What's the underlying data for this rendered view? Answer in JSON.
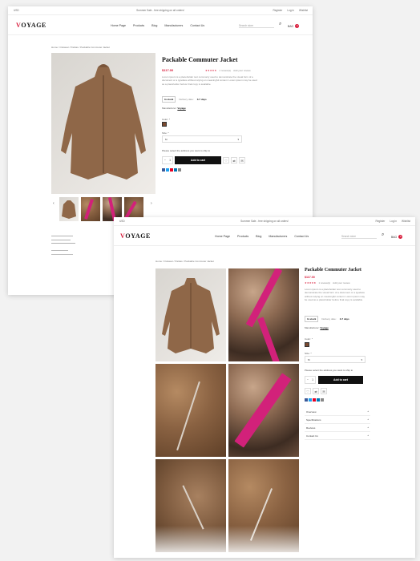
{
  "topbar": {
    "currency": "USD",
    "announcement": "Summer Sale - free shipping on all orders!",
    "links": [
      "Register",
      "Log in",
      "Wishlist"
    ]
  },
  "header": {
    "logo_accent": "V",
    "logo_rest": "OYAGE",
    "nav": [
      "Home Page",
      "Products",
      "Blog",
      "Manufacturers",
      "Contact Us"
    ],
    "search_placeholder": "Search store",
    "bag_label": "BAG",
    "bag_count": "0"
  },
  "breadcrumb": "Home  /  Outwear  /  Parkas  /  Packable Commuter Jacket",
  "product": {
    "title": "Packable Commuter Jacket",
    "price": "$117.00",
    "stars": "★★★★★",
    "reviews": "1 review(s)",
    "add_review": "Add your review",
    "description": "Lorem ipsum is a placeholder text commonly used to demonstrate the visual form of a document or a typeface without relying on meaningful content. Lorem ipsum may be used as a placeholder before final copy is available.",
    "stock": "In stock",
    "delivery_label": "Delivery date:",
    "delivery_value": "3-7 days",
    "manufacturer_label": "Manufacturer:",
    "manufacturer_value": "Voyage",
    "color_label": "Color: *",
    "size_label": "Size: *",
    "size_value": "M",
    "address_prompt": "Please select the address you want to ship to",
    "qty": "1",
    "qty_minus": "−",
    "qty_plus": "+",
    "add_to_cart": "Add to cart"
  },
  "accordion": [
    "Overview",
    "Specifications",
    "Reviews",
    "Contact Us"
  ],
  "colors": {
    "accent": "#d81b3a",
    "swatch": "#7a4a30",
    "strap": "#d2217a"
  },
  "icons": [
    "search-icon",
    "user-icon",
    "heart-icon",
    "compare-icon",
    "email-icon",
    "chevron-down-icon",
    "arrow-left-icon",
    "arrow-right-icon"
  ]
}
